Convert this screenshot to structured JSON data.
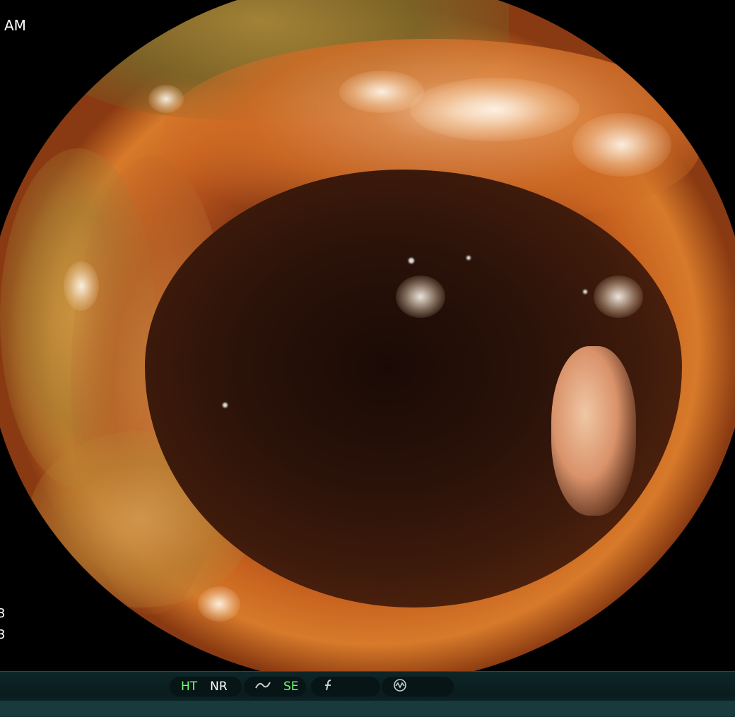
{
  "overlay": {
    "corner_text": "AM",
    "left_edge_top": "3",
    "left_edge_bottom": "3"
  },
  "status_bar": {
    "group1": {
      "ht": "HT",
      "nr": "NR"
    },
    "group2": {
      "icon": "scope-curve-icon",
      "se": "SE"
    },
    "group3": {
      "icon": "f-script-icon"
    },
    "group4": {
      "icon": "wave-circle-icon"
    }
  },
  "colors": {
    "active_label": "#6dff6d",
    "inactive_label": "#ffffff",
    "bar_background": "#0d2628"
  }
}
